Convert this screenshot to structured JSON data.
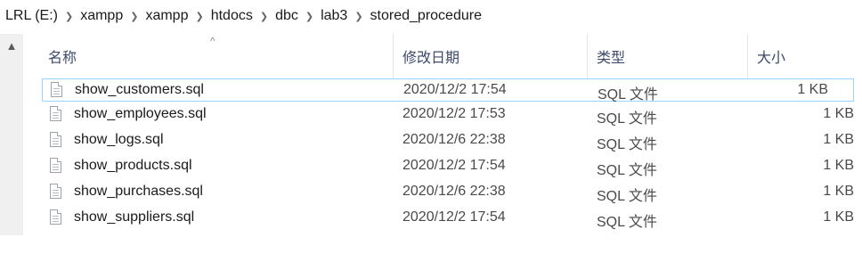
{
  "breadcrumb": [
    "LRL (E:)",
    "xampp",
    "xampp",
    "htdocs",
    "dbc",
    "lab3",
    "stored_procedure"
  ],
  "header": {
    "name": "名称",
    "date": "修改日期",
    "type": "类型",
    "size": "大小"
  },
  "files": [
    {
      "name": "show_customers.sql",
      "date": "2020/12/2 17:54",
      "type": "SQL 文件",
      "size": "1 KB"
    },
    {
      "name": "show_employees.sql",
      "date": "2020/12/2 17:53",
      "type": "SQL 文件",
      "size": "1 KB"
    },
    {
      "name": "show_logs.sql",
      "date": "2020/12/6 22:38",
      "type": "SQL 文件",
      "size": "1 KB"
    },
    {
      "name": "show_products.sql",
      "date": "2020/12/2 17:54",
      "type": "SQL 文件",
      "size": "1 KB"
    },
    {
      "name": "show_purchases.sql",
      "date": "2020/12/6 22:38",
      "type": "SQL 文件",
      "size": "1 KB"
    },
    {
      "name": "show_suppliers.sql",
      "date": "2020/12/2 17:54",
      "type": "SQL 文件",
      "size": "1 KB"
    }
  ],
  "icons": {
    "separator": "chevron-right-icon",
    "file": "document-icon",
    "sort": "sort-ascending-icon",
    "scroll_up": "scroll-up-icon"
  }
}
